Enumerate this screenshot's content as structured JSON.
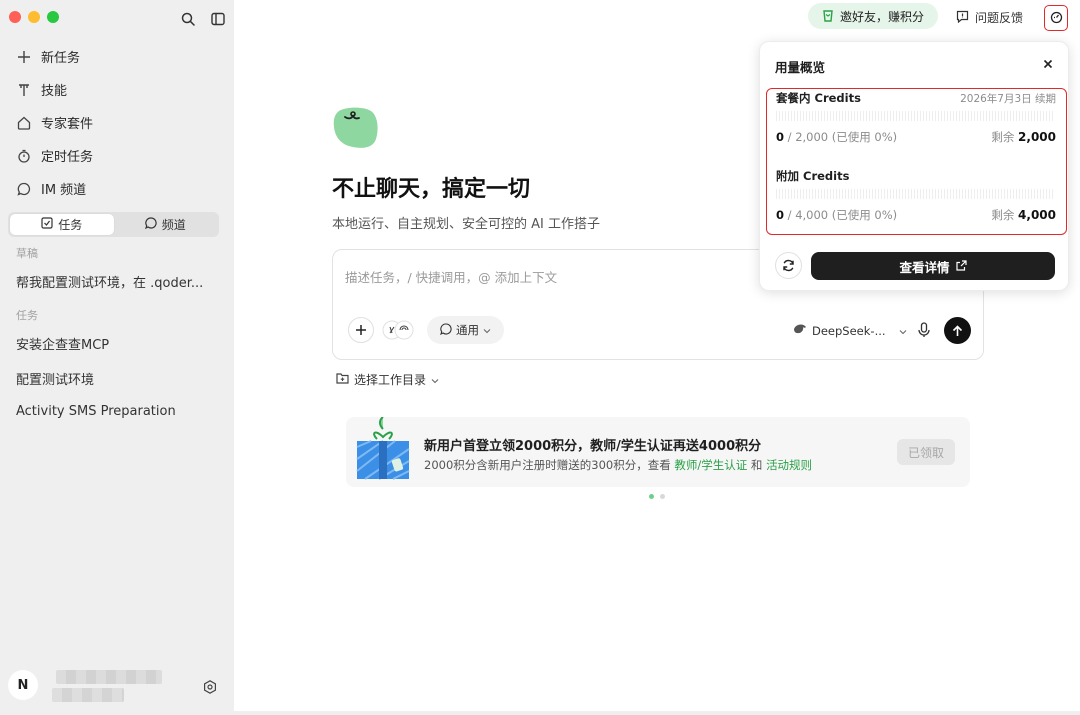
{
  "sidebar": {
    "nav": [
      {
        "icon": "plus-icon",
        "label": "新任务"
      },
      {
        "icon": "skill-icon",
        "label": "技能"
      },
      {
        "icon": "expert-icon",
        "label": "专家套件"
      },
      {
        "icon": "timer-icon",
        "label": "定时任务"
      },
      {
        "icon": "chat-icon",
        "label": "IM 频道"
      }
    ],
    "segments": {
      "tasks": "任务",
      "channels": "频道"
    },
    "drafts_label": "草稿",
    "drafts": [
      "帮我配置测试环境，在 .qoder..."
    ],
    "tasks_label": "任务",
    "tasks": [
      "安装企查查MCP",
      "配置测试环境",
      "Activity SMS Preparation"
    ],
    "user_initial": "N"
  },
  "topbar": {
    "invite": "邀好友，赚积分",
    "feedback": "问题反馈"
  },
  "main": {
    "headline": "不止聊天，搞定一切",
    "subtitle": "本地运行、自主规划、安全可控的 AI 工作搭子",
    "composer_placeholder": "描述任务，/ 快捷调用，@ 添加上下文",
    "mode": "通用",
    "model": "DeepSeek-...",
    "workdir": "选择工作目录"
  },
  "promo": {
    "title": "新用户首登立领2000积分，教师/学生认证再送4000积分",
    "desc_prefix": "2000积分含新用户注册时赠送的300积分，查看",
    "link1": "教师/学生认证",
    "desc_mid": "和",
    "link2": "活动规则",
    "button": "已领取",
    "carousel_index": 0,
    "carousel_count": 2
  },
  "usage": {
    "title": "用量概览",
    "plan": {
      "title": "套餐内 Credits",
      "renewal": "2026年7月3日 续期",
      "used": "0",
      "total": "/ 2,000",
      "pct": "(已使用 0%)",
      "remaining_label": "剩余",
      "remaining": "2,000"
    },
    "addon": {
      "title": "附加 Credits",
      "used": "0",
      "total": "/ 4,000",
      "pct": "(已使用 0%)",
      "remaining_label": "剩余",
      "remaining": "4,000"
    },
    "details_button": "查看详情"
  },
  "colors": {
    "accent_green": "#2aa148",
    "highlight_red": "#e02a2a",
    "sidebar_bg": "#efefef"
  }
}
